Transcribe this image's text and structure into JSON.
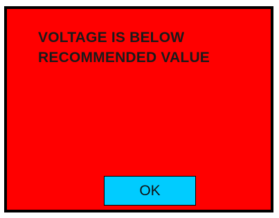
{
  "dialog": {
    "message_line1": "VOLTAGE IS BELOW",
    "message_line2": "RECOMMENDED VALUE",
    "ok_label": "OK"
  },
  "colors": {
    "background": "#ff0000",
    "border": "#000000",
    "button": "#00ccff",
    "text": "#1a1a1a"
  }
}
